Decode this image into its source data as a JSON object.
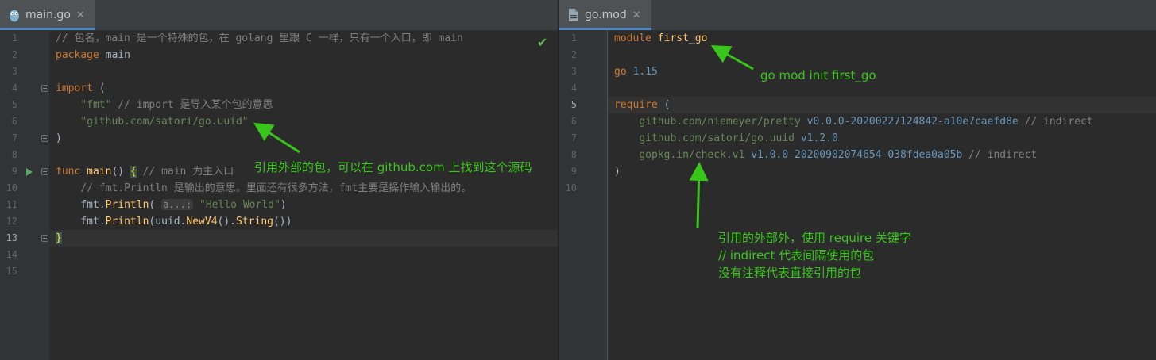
{
  "left": {
    "tab": {
      "label": "main.go",
      "icon": "gopher-icon",
      "close": "✕"
    },
    "lines": [
      {
        "n": "1",
        "segs": [
          [
            "cmt",
            "// 包名，main 是一个特殊的包，在 golang 里跟 C 一样，只有一个入口，即 main"
          ]
        ]
      },
      {
        "n": "2",
        "segs": [
          [
            "kw",
            "package"
          ],
          [
            "",
            " main"
          ]
        ]
      },
      {
        "n": "3",
        "segs": []
      },
      {
        "n": "4",
        "segs": [
          [
            "kw",
            "import"
          ],
          [
            "",
            " ("
          ]
        ]
      },
      {
        "n": "5",
        "segs": [
          [
            "",
            "    "
          ],
          [
            "str",
            "\"fmt\""
          ],
          [
            "",
            " "
          ],
          [
            "cmt",
            "// import 是导入某个包的意思"
          ]
        ]
      },
      {
        "n": "6",
        "segs": [
          [
            "",
            "    "
          ],
          [
            "str",
            "\"github.com/satori/go.uuid\""
          ]
        ]
      },
      {
        "n": "7",
        "segs": [
          [
            "",
            ")"
          ]
        ]
      },
      {
        "n": "8",
        "segs": []
      },
      {
        "n": "9",
        "segs": [
          [
            "kw",
            "func"
          ],
          [
            "",
            " "
          ],
          [
            "fn",
            "main"
          ],
          [
            "",
            "() "
          ],
          [
            "brace-hl",
            "{"
          ],
          [
            "",
            " "
          ],
          [
            "cmt",
            "// main 为主入口"
          ]
        ]
      },
      {
        "n": "10",
        "segs": [
          [
            "",
            "    "
          ],
          [
            "cmt",
            "// fmt.Println 是输出的意思。里面还有很多方法，fmt主要是操作输入输出的。"
          ]
        ]
      },
      {
        "n": "11",
        "segs": [
          [
            "",
            "    fmt."
          ],
          [
            "fn",
            "Println"
          ],
          [
            "",
            "( "
          ],
          [
            "hint",
            "a...:"
          ],
          [
            "",
            " "
          ],
          [
            "str",
            "\"Hello World\""
          ],
          [
            "",
            ")"
          ]
        ]
      },
      {
        "n": "12",
        "segs": [
          [
            "",
            "    fmt."
          ],
          [
            "fn",
            "Println"
          ],
          [
            "",
            "(uuid."
          ],
          [
            "fn",
            "NewV4"
          ],
          [
            "",
            "()."
          ],
          [
            "fn",
            "String"
          ],
          [
            "",
            "())"
          ]
        ]
      },
      {
        "n": "13",
        "segs": [
          [
            "brace-hl",
            "}"
          ]
        ]
      },
      {
        "n": "14",
        "segs": []
      },
      {
        "n": "15",
        "segs": []
      }
    ],
    "current_line": "13",
    "annotation": "引用外部的包，可以在 github.com 上找到这个源码"
  },
  "right": {
    "tab": {
      "label": "go.mod",
      "icon": "file-icon",
      "close": "✕"
    },
    "lines": [
      {
        "n": "1",
        "segs": [
          [
            "kw",
            "module"
          ],
          [
            "",
            " "
          ],
          [
            "fn",
            "first_go"
          ]
        ]
      },
      {
        "n": "2",
        "segs": []
      },
      {
        "n": "3",
        "segs": [
          [
            "kw",
            "go"
          ],
          [
            "",
            " "
          ],
          [
            "num",
            "1.15"
          ]
        ]
      },
      {
        "n": "4",
        "segs": []
      },
      {
        "n": "5",
        "segs": [
          [
            "kw",
            "require"
          ],
          [
            "",
            " ("
          ]
        ]
      },
      {
        "n": "6",
        "segs": [
          [
            "",
            "    "
          ],
          [
            "str",
            "github.com/niemeyer/pretty"
          ],
          [
            "",
            " "
          ],
          [
            "ver",
            "v0.0.0-20200227124842-a10e7caefd8e"
          ],
          [
            "",
            " "
          ],
          [
            "cmt",
            "// indirect"
          ]
        ]
      },
      {
        "n": "7",
        "segs": [
          [
            "",
            "    "
          ],
          [
            "str",
            "github.com/satori/go.uuid"
          ],
          [
            "",
            " "
          ],
          [
            "ver",
            "v1.2.0"
          ]
        ]
      },
      {
        "n": "8",
        "segs": [
          [
            "",
            "    "
          ],
          [
            "str",
            "gopkg.in/check.v1"
          ],
          [
            "",
            " "
          ],
          [
            "ver",
            "v1.0.0-20200902074654-038fdea0a05b"
          ],
          [
            "",
            " "
          ],
          [
            "cmt",
            "// indirect"
          ]
        ]
      },
      {
        "n": "9",
        "segs": [
          [
            "",
            ")"
          ]
        ]
      },
      {
        "n": "10",
        "segs": []
      }
    ],
    "current_line": "5",
    "annotation_module": "go mod init first_go",
    "annotation_require": [
      "引用的外部外，使用 require 关键字",
      "// indirect 代表间隔使用的包",
      "没有注释代表直接引用的包"
    ]
  },
  "colors": {
    "annotation": "#39c61a",
    "keyword": "#cc7832",
    "string": "#6a8759",
    "comment": "#808080",
    "function": "#ffc66d",
    "number": "#6897bb"
  }
}
